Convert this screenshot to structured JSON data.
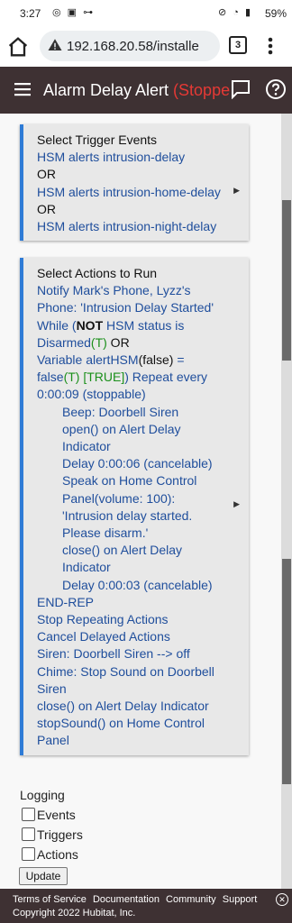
{
  "status_bar": {
    "time": "3:27",
    "battery": "59%",
    "left_icons": "◎ ▣ ⊶",
    "right_icons": "⊘ ◔ ▮"
  },
  "browser": {
    "url": "192.168.20.58/installe",
    "tab_count": "3"
  },
  "app_bar": {
    "title": "Alarm Delay Alert ",
    "status": "(Stopped)"
  },
  "trigger_card": {
    "title": "Select Trigger Events",
    "lines": [
      {
        "text": "HSM alerts intrusion-delay",
        "style": "blue"
      },
      {
        "text": "OR",
        "style": "blk"
      },
      {
        "text": "HSM alerts intrusion-home-delay",
        "style": "blue"
      },
      {
        "text": "OR",
        "style": "blk"
      },
      {
        "text": "HSM alerts intrusion-night-delay",
        "style": "blue"
      }
    ]
  },
  "actions_card": {
    "title": "Select Actions to Run",
    "notify": "Notify Mark's Phone, Lyzz's Phone: 'Intrusion Delay Started'",
    "while_1": "While (",
    "while_not": "NOT",
    "while_2": " HSM status is Disarmed",
    "while_t": "(T)",
    "while_or": "  OR",
    "var_1": "Variable alertHSM",
    "var_false": "(false)",
    "var_2": " = false",
    "var_t": "(T) [TRUE]",
    "var_3": ") Repeat every 0:00:09 (stoppable)",
    "beep": "Beep: Doorbell Siren",
    "open": "open() on Alert Delay Indicator",
    "delay1": "Delay 0:00:06 (cancelable)",
    "speak": "Speak on Home Control Panel(volume: 100): 'Intrusion delay started. Please disarm.'",
    "close1": "close() on Alert Delay Indicator",
    "delay2": "Delay 0:00:03 (cancelable)",
    "endrep": "END-REP",
    "stop_rep": "Stop Repeating Actions",
    "cancel": "Cancel Delayed Actions",
    "siren": "Siren: Doorbell Siren --> off",
    "chime": "Chime: Stop Sound on Doorbell Siren",
    "close2": "close() on Alert Delay Indicator",
    "stopsound": "stopSound() on Home Control Panel"
  },
  "logging": {
    "label": "Logging",
    "options": [
      {
        "label": "Events",
        "checked": false
      },
      {
        "label": "Triggers",
        "checked": false
      },
      {
        "label": "Actions",
        "checked": false
      }
    ],
    "update_label": "Update"
  },
  "footer": {
    "links": [
      "Terms of Service",
      "Documentation",
      "Community",
      "Support"
    ],
    "copyright": "Copyright 2022 Hubitat, Inc.",
    "close_glyph": "✕"
  },
  "colors": {
    "appbar": "#3e3133",
    "card_accent": "#2e7bd6",
    "link_blue": "#1f4e9c",
    "true_green": "#1a8f1a",
    "stopped_red": "#e53935"
  }
}
